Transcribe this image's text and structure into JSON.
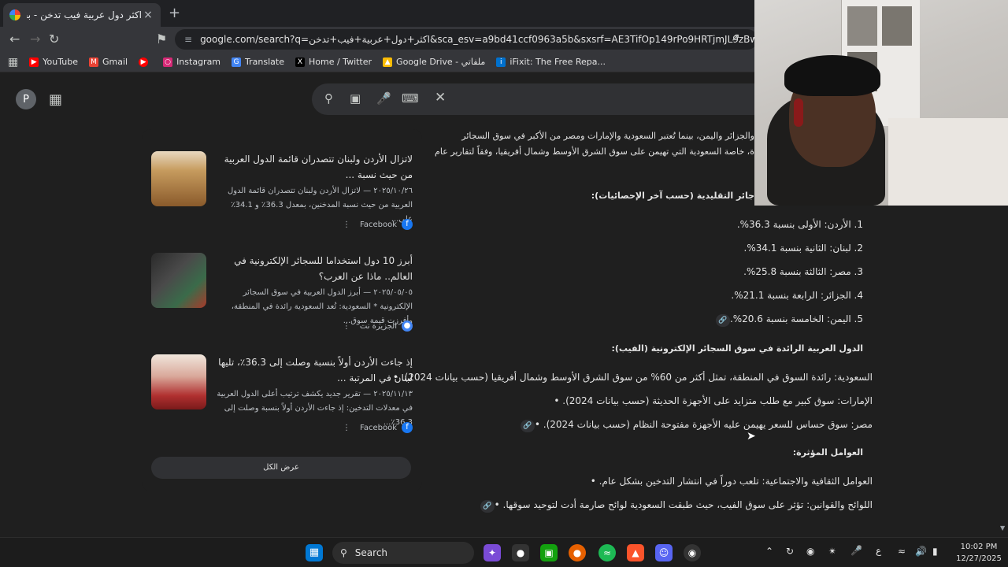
{
  "tab": {
    "title": "اكثر دول عربية فيب تدخن - بحث Google",
    "close": "×",
    "new_tab": "+"
  },
  "omnibox": {
    "url": "google.com/search?q=اكثر+دول+عربية+فيب+تدخن&sca_esv=a9bd41ccf0963a5b&sxsrf=AE3TifOp149rPo9HRTjmJL9zBwMbW6E..."
  },
  "bookmarks": [
    {
      "label": "YouTube",
      "icon": "youtube-icon",
      "color": "#ff0000"
    },
    {
      "label": "Gmail",
      "icon": "gmail-icon",
      "color": "#ea4335"
    },
    {
      "label": "",
      "icon": "youtube-music-icon",
      "color": "#ff0000"
    },
    {
      "label": "Instagram",
      "icon": "instagram-icon",
      "color": "#d62976"
    },
    {
      "label": "Translate",
      "icon": "translate-icon",
      "color": "#4285f4"
    },
    {
      "label": "Home / Twitter",
      "icon": "x-icon",
      "color": "#000000"
    },
    {
      "label": "Google Drive - ملفاتي",
      "icon": "drive-icon",
      "color": "#fbbc05"
    },
    {
      "label": "iFixit: The Free Repa...",
      "icon": "ifixit-icon",
      "color": "#0071ce"
    }
  ],
  "avatar_letter": "P",
  "results": [
    {
      "title": "لاتزال الأردن ولبنان تتصدران قائمة الدول العربية من حيث نسبة ...",
      "snippet": "٢٠٢٥/١٠/٢٦ — لاتزال الأردن ولبنان تتصدران قائمة الدول العربية من حيث نسبة المدخنين، بمعدل 36.3٪ و 34.1٪ على...",
      "source": "Facebook"
    },
    {
      "title": "أبرز 10 دول استخداما للسجائر الإلكترونية في العالم.. ماذا عن العرب؟",
      "snippet": "٢٠٢٥/٠٥/٠٥ — أبرز الدول العربية في سوق السجائر الإلكترونية * السعودية: تُعد السعودية رائدة في المنطقة، وأفرزت قيمة سوق...",
      "source": "الجزيرة نت"
    },
    {
      "title": "إذ جاءت الأردن أولاً بنسبة وصلت إلى 36.3٪، تليها لبنان في المرتبة ...",
      "snippet": "٢٠٢٥/١١/١٣ — تقرير جديد يكشف ترتيب أعلى الدول العربية في معدلات التدخين: إذ جاءت الأردن أولاً بنسبة وصلت إلى 36.3٪...",
      "source": "Facebook"
    }
  ],
  "show_all": "عرض الكل",
  "ai": {
    "intro_1": "والجزائر واليمن، بينما تُعتبر السعودية والإمارات ومصر من الأكبر في سوق السجائر",
    "intro_2": "ة، خاصة السعودية التي تهيمن على سوق الشرق الأوسط وشمال أفريقيا، وفقاً لتقارير عام",
    "ranking_heading": "جائر التقليدية (حسب آخر الإحصائيات):",
    "ranking": [
      "1. الأردن: الأولى بنسبة 36.3%.",
      "2. لبنان: الثانية بنسبة 34.1%.",
      "3. مصر: الثالثة بنسبة 25.8%.",
      "4. الجزائر: الرابعة بنسبة 21.1%.",
      "5. اليمن: الخامسة بنسبة 20.6%."
    ],
    "vape_heading": "الدول العربية الرائدة في سوق السجائر الإلكترونية (الفيب):",
    "vape": [
      "السعودية: رائدة السوق في المنطقة، تمثل أكثر من 60% من سوق الشرق الأوسط وشمال أفريقيا (حسب بيانات 2024).",
      "الإمارات: سوق كبير مع طلب متزايد على الأجهزة الحديثة (حسب بيانات 2024).",
      "مصر: سوق حساس للسعر يهيمن عليه الأجهزة مفتوحة النظام (حسب بيانات 2024)."
    ],
    "factors_heading": "العوامل المؤثرة:",
    "factors": [
      "العوامل الثقافية والاجتماعية: تلعب دوراً في انتشار التدخين بشكل عام.",
      "اللوائح والقوانين: تؤثر على سوق الفيب، حيث طبقت السعودية لوائح صارمة أدت لتوحيد سوقها."
    ]
  },
  "taskbar": {
    "search_label": "Search",
    "time": "10:02 PM",
    "date": "12/27/2025",
    "lang": "ع"
  }
}
